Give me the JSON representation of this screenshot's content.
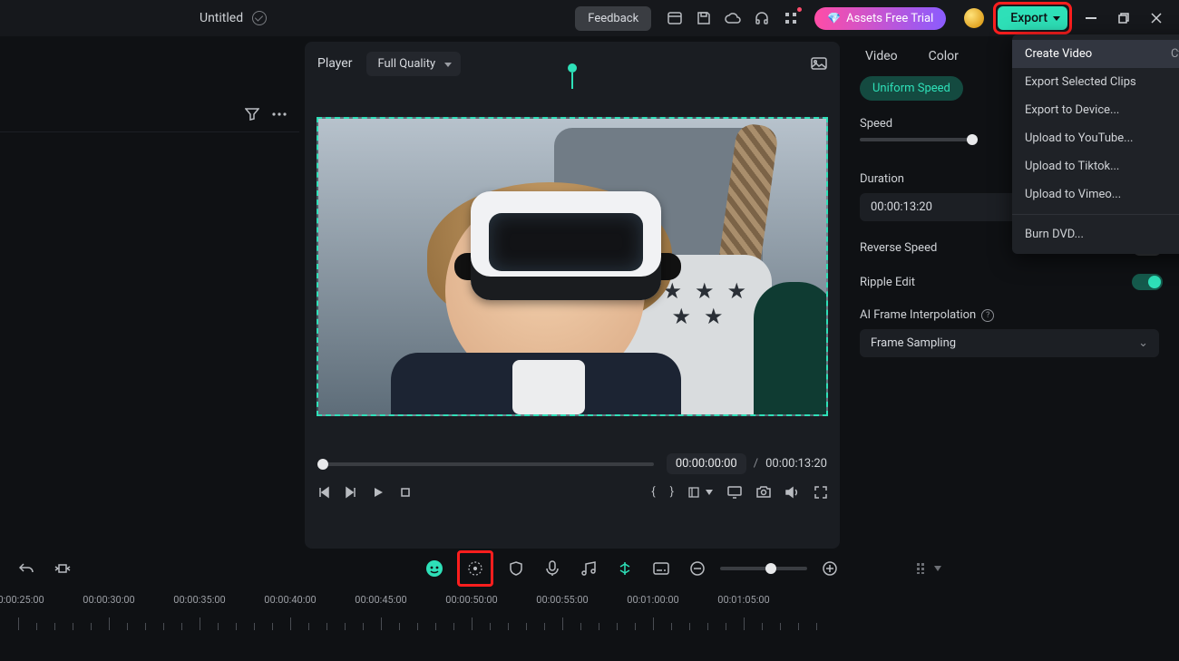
{
  "titlebar": {
    "doc_title": "Untitled",
    "feedback": "Feedback",
    "assets": "Assets Free Trial",
    "export": "Export"
  },
  "export_menu": {
    "create_video": "Create Video",
    "create_video_shortcut": "Ctrl+E",
    "export_selected": "Export Selected Clips",
    "export_device": "Export to Device...",
    "upload_youtube": "Upload to YouTube...",
    "upload_tiktok": "Upload to Tiktok...",
    "upload_vimeo": "Upload to Vimeo...",
    "burn_dvd": "Burn DVD..."
  },
  "preview": {
    "player_label": "Player",
    "quality": "Full Quality",
    "current_time": "00:00:00:00",
    "sep": "/",
    "total_time": "00:00:13:20"
  },
  "inspector": {
    "tab_video": "Video",
    "tab_color": "Color",
    "chip_uniform": "Uniform Speed",
    "speed_label": "Speed",
    "duration_label": "Duration",
    "duration_value": "00:00:13:20",
    "reverse_label": "Reverse Speed",
    "ripple_label": "Ripple Edit",
    "ai_label": "AI Frame Interpolation",
    "ai_value": "Frame Sampling"
  },
  "timeline": {
    "labels": [
      "00:00:25:00",
      "00:00:30:00",
      "00:00:35:00",
      "00:00:40:00",
      "00:00:45:00",
      "00:00:50:00",
      "00:00:55:00",
      "00:01:00:00",
      "00:01:05:00"
    ]
  }
}
